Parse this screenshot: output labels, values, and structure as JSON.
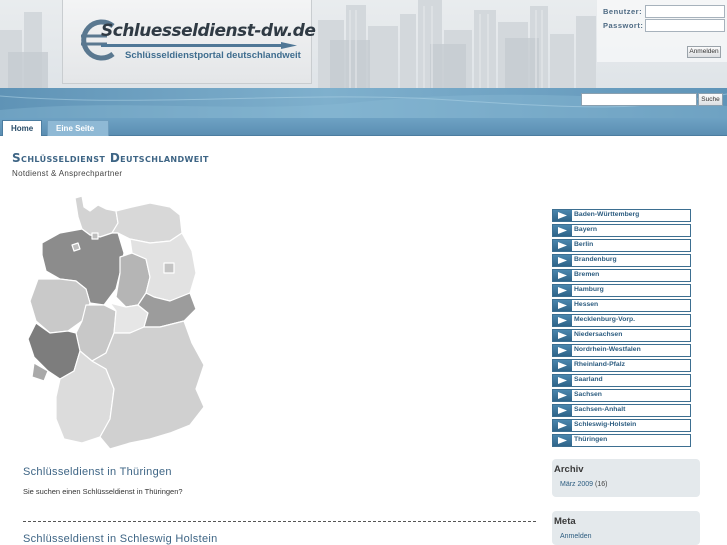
{
  "site": {
    "logo_title": "Schluesseldienst-dw.de",
    "logo_tagline": "Schlüsseldienstportal deutschlandweit"
  },
  "login": {
    "user_label": "Benutzer:",
    "password_label": "Passwort:",
    "user_value": "",
    "password_value": "",
    "submit_label": "Anmelden"
  },
  "search": {
    "value": "",
    "button_label": "Suche"
  },
  "nav": {
    "tabs": [
      {
        "label": "Home",
        "active": true
      },
      {
        "label": "Eine Seite",
        "active": false
      }
    ]
  },
  "main": {
    "title": "Schlüsseldienst Deutschlandweit",
    "subtitle": "Notdienst & Ansprechpartner",
    "posts": [
      {
        "title": "Schlüsseldienst in Thüringen",
        "excerpt": "Sie suchen einen Schlüsseldienst in Thüringen?"
      },
      {
        "title": "Schlüsseldienst in Schleswig Holstein"
      }
    ]
  },
  "sidebar": {
    "states": [
      "Baden-Württemberg",
      "Bayern",
      "Berlin",
      "Brandenburg",
      "Bremen",
      "Hamburg",
      "Hessen",
      "Mecklenburg-Vorp.",
      "Niedersachsen",
      "Nordrhein-Westfalen",
      "Rheinland-Pfalz",
      "Saarland",
      "Sachsen",
      "Sachsen-Anhalt",
      "Schleswig-Holstein",
      "Thüringen"
    ],
    "archive": {
      "title": "Archiv",
      "items": [
        {
          "label": "März 2009",
          "count": "(16)"
        }
      ]
    },
    "meta": {
      "title": "Meta",
      "items": [
        "Anmelden"
      ]
    }
  },
  "colors": {
    "accent": "#3e6585",
    "band": "#6fa3c5",
    "nav": "#5b8eb2",
    "map_dark": "#8a8a8a",
    "map_light": "#d9d9d9"
  }
}
